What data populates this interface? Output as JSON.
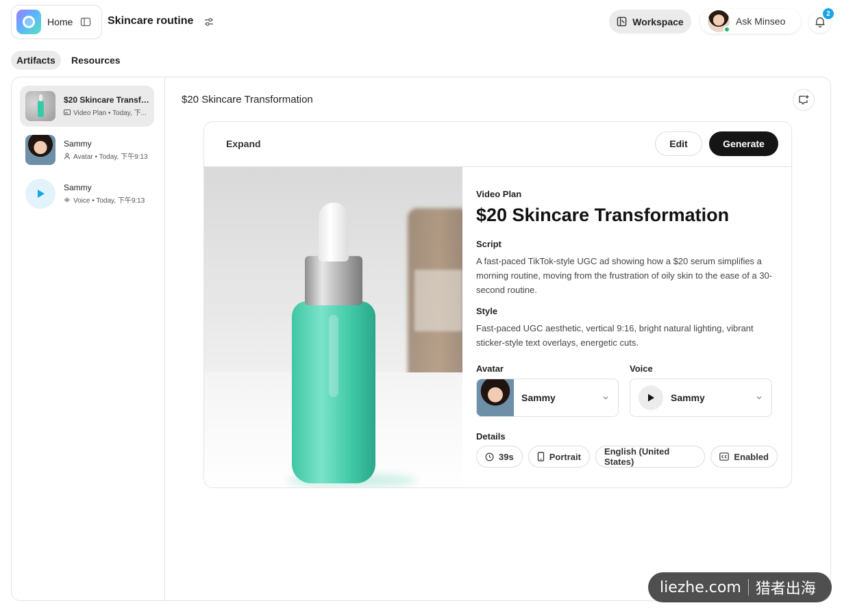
{
  "header": {
    "home_label": "Home",
    "project_title": "Skincare routine",
    "workspace_label": "Workspace",
    "ask_label": "Ask Minseo",
    "notification_count": "2"
  },
  "tabs": [
    {
      "label": "Artifacts",
      "active": true
    },
    {
      "label": "Resources",
      "active": false
    }
  ],
  "sidebar": {
    "items": [
      {
        "title": "$20 Skincare Transfo...",
        "meta": "Video Plan • Today, 下...",
        "icon": "video-plan-icon",
        "active": true
      },
      {
        "title": "Sammy",
        "meta": "Avatar • Today, 下午9:13",
        "icon": "person-icon",
        "active": false
      },
      {
        "title": "Sammy",
        "meta": "Voice • Today, 下午9:13",
        "icon": "waveform-icon",
        "active": false
      }
    ]
  },
  "content": {
    "title": "$20 Skincare Transformation",
    "expand_label": "Expand",
    "edit_label": "Edit",
    "generate_label": "Generate",
    "plan": {
      "type_label": "Video Plan",
      "title": "$20 Skincare Transformation",
      "script_label": "Script",
      "script_text": "A fast-paced TikTok-style UGC ad showing how a $20 serum simplifies a morning routine, moving from the frustration of oily skin to the ease of a 30-second routine.",
      "style_label": "Style",
      "style_text": "Fast-paced UGC aesthetic, vertical 9:16, bright natural lighting, vibrant sticker-style text overlays, energetic cuts.",
      "avatar_label": "Avatar",
      "avatar_value": "Sammy",
      "voice_label": "Voice",
      "voice_value": "Sammy",
      "details_label": "Details",
      "chips": [
        {
          "label": "39s",
          "icon": "clock-icon"
        },
        {
          "label": "Portrait",
          "icon": "phone-icon"
        },
        {
          "label": "English (United States)",
          "icon": ""
        },
        {
          "label": "Enabled",
          "icon": "captions-icon"
        }
      ]
    }
  },
  "watermark": {
    "left": "liezhe.com",
    "right": "猎者出海"
  },
  "colors": {
    "accent_dark": "#151515",
    "badge": "#1aa3e8",
    "online": "#22b573",
    "serum": "#41c9a6"
  }
}
